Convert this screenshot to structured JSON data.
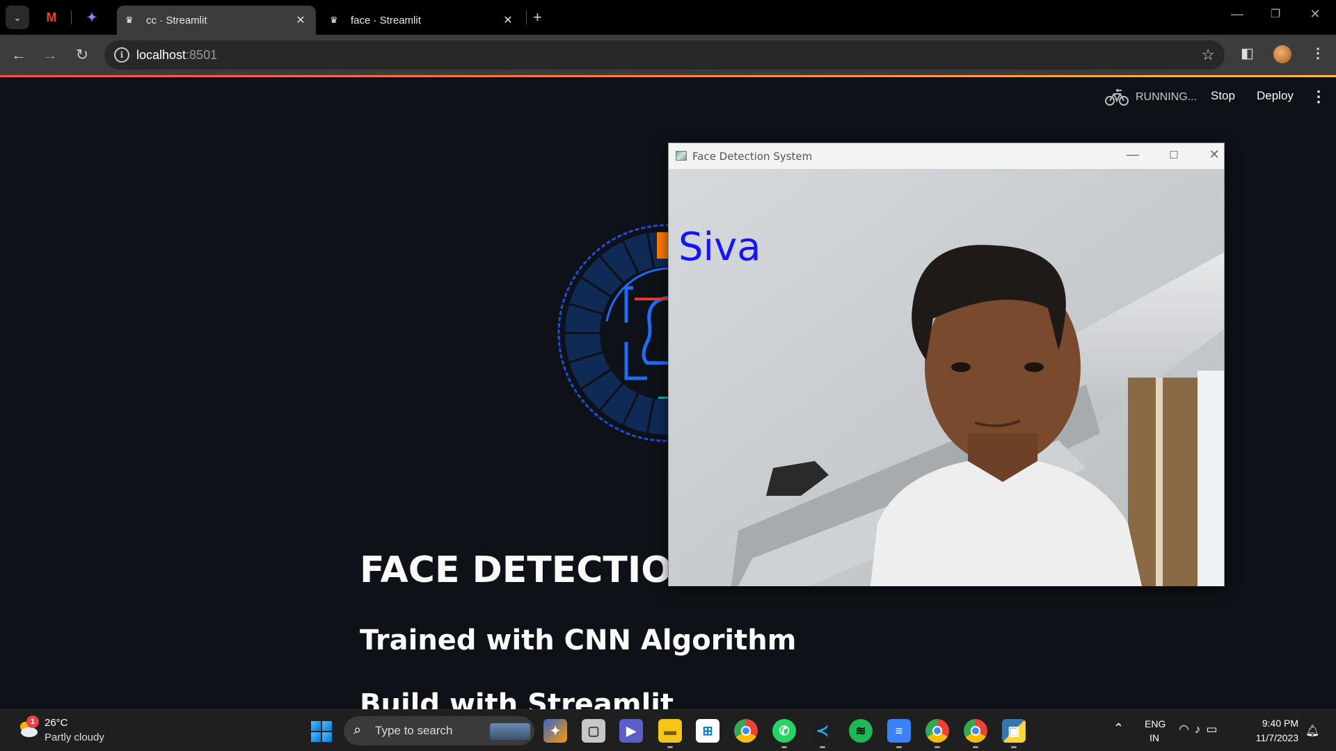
{
  "browser": {
    "tabs": [
      {
        "title": "cc · Streamlit",
        "active": true
      },
      {
        "title": "face · Streamlit",
        "active": false
      }
    ],
    "pinned_icons": [
      "gmail-icon",
      "gemini-icon"
    ],
    "address": {
      "host": "localhost",
      "port": ":8501"
    }
  },
  "streamlit": {
    "status": "RUNNING...",
    "stop_label": "Stop",
    "deploy_label": "Deploy"
  },
  "page": {
    "title": "FACE DETECTION",
    "subtitle": "Trained with CNN Algorithm",
    "subtitle2": "Build with Streamlit"
  },
  "cv_window": {
    "title": "Face Detection System",
    "label": "Siva",
    "label_color": "#1414ff"
  },
  "taskbar": {
    "weather": {
      "temp": "26°C",
      "desc": "Partly cloudy",
      "badge": "1"
    },
    "search_placeholder": "Type to search",
    "lang_line1": "ENG",
    "lang_line2": "IN",
    "time": "9:40 PM",
    "date": "11/7/2023"
  },
  "colors": {
    "page_bg": "#0e1117",
    "accent_gradient": [
      "#ff4b4b",
      "#ffbd45"
    ]
  }
}
